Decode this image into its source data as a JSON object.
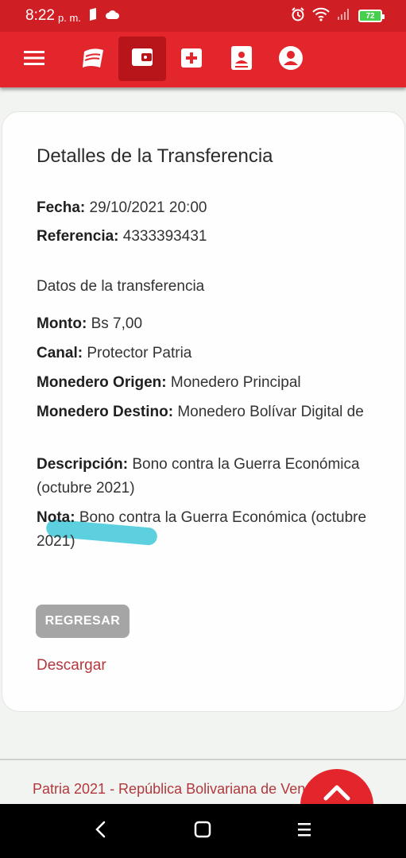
{
  "status_bar": {
    "time": "8:22",
    "ampm": "p. m.",
    "battery": "72"
  },
  "nav": {
    "items": [
      {
        "icon": "menu-icon"
      },
      {
        "icon": "patria-logo-icon"
      },
      {
        "icon": "wallet-icon",
        "active": true
      },
      {
        "icon": "health-cross-icon"
      },
      {
        "icon": "id-card-icon"
      },
      {
        "icon": "account-icon"
      }
    ]
  },
  "details": {
    "title": "Detalles de la Transferencia",
    "fecha_label": "Fecha:",
    "fecha_value": "29/10/2021 20:00",
    "referencia_label": "Referencia:",
    "referencia_value": "4333393431",
    "section_title": "Datos de la transferencia",
    "monto_label": "Monto:",
    "monto_value": "Bs 7,00",
    "canal_label": "Canal:",
    "canal_value": "Protector Patria",
    "origen_label": "Monedero Origen:",
    "origen_value": "Monedero Principal",
    "destino_label": "Monedero Destino:",
    "destino_value": "Monedero Bolívar Digital de",
    "descripcion_label": "Descripción:",
    "descripcion_value": "Bono contra la Guerra Económica (octubre 2021)",
    "nota_label": "Nota:",
    "nota_value": "Bono contra la Guerra Económica (octubre 2021)",
    "back_button": "REGRESAR",
    "download_link": "Descargar"
  },
  "footer": {
    "text": "Patria 2021 - República Bolivariana de Venezuela"
  },
  "colors": {
    "primary_red": "#e3262b",
    "dark_red": "#b71519",
    "link_red": "#b3383c",
    "button_gray": "#a5a5a5"
  }
}
